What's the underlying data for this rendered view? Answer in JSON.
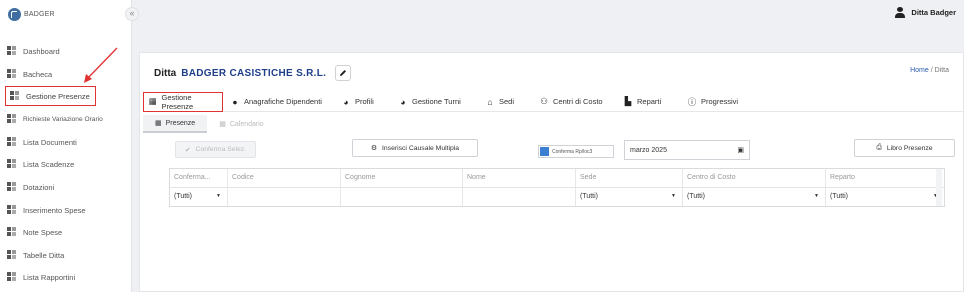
{
  "brand": {
    "name": "BADGER"
  },
  "sidebar": {
    "collapse_icon": "«",
    "items": [
      {
        "label": "Dashboard",
        "icon": "grid-icon"
      },
      {
        "label": "Bacheca",
        "icon": "grid-icon"
      },
      {
        "label": "Gestione Presenze",
        "icon": "grid-icon",
        "active": true
      },
      {
        "label": "Richieste Variazione Orario",
        "icon": "grid-icon"
      },
      {
        "label": "Lista Documenti",
        "icon": "grid-icon"
      },
      {
        "label": "Lista Scadenze",
        "icon": "grid-icon"
      },
      {
        "label": "Dotazioni",
        "icon": "grid-icon"
      },
      {
        "label": "Inserimento Spese",
        "icon": "grid-icon"
      },
      {
        "label": "Note Spese",
        "icon": "grid-icon"
      },
      {
        "label": "Tabelle Ditta",
        "icon": "grid-icon"
      },
      {
        "label": "Lista Rapportini",
        "icon": "grid-icon"
      }
    ]
  },
  "topbar": {
    "user": "Ditta Badger",
    "user_icon": "user-icon"
  },
  "header": {
    "prefix": "Ditta",
    "company": "BADGER CASISTICHE S.R.L.",
    "breadcrumb_home": "Home",
    "breadcrumb_sep": " / ",
    "breadcrumb_current": "Ditta"
  },
  "tabs": [
    {
      "label": "Gestione Presenze",
      "icon": "calendar-icon",
      "active": true
    },
    {
      "label": "Anagrafiche Dipendenti",
      "icon": "person-icon"
    },
    {
      "label": "Profili",
      "icon": "person-gear-icon"
    },
    {
      "label": "Gestione Turni",
      "icon": "person-gear-icon"
    },
    {
      "label": "Sedi",
      "icon": "home-icon"
    },
    {
      "label": "Centri di Costo",
      "icon": "network-icon"
    },
    {
      "label": "Reparti",
      "icon": "factory-icon"
    },
    {
      "label": "Progressivi",
      "icon": "info-icon"
    }
  ],
  "subtabs": [
    {
      "label": "Presenze",
      "active": true
    },
    {
      "label": "Calendario",
      "disabled": true
    }
  ],
  "toolbar": {
    "confirm_label": "Conferma Selez.",
    "multi_label": "Inserisci Causale Multipla",
    "toggle_label": "Conferma Rp/loc3",
    "month_value": "marzo 2025",
    "book_label": "Libro Presenze"
  },
  "grid": {
    "columns": [
      "Conferma...",
      "Codice",
      "Cognome",
      "Nome",
      "Sede",
      "Centro di Costo",
      "Reparto"
    ],
    "filters": [
      "(Tutti)",
      "",
      "",
      "",
      "(Tutti)",
      "(Tutti)",
      "(Tutti)"
    ]
  },
  "colors": {
    "accent": "#1f3f8a",
    "highlight": "#e03232",
    "link": "#2a5db0"
  }
}
